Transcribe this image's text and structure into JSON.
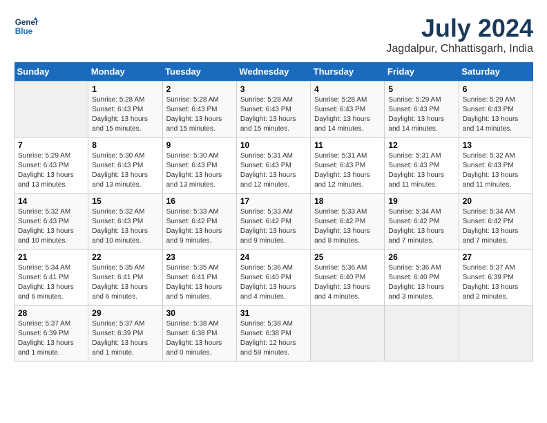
{
  "header": {
    "logo_line1": "General",
    "logo_line2": "Blue",
    "month_year": "July 2024",
    "location": "Jagdalpur, Chhattisgarh, India"
  },
  "weekdays": [
    "Sunday",
    "Monday",
    "Tuesday",
    "Wednesday",
    "Thursday",
    "Friday",
    "Saturday"
  ],
  "weeks": [
    [
      {
        "day": "",
        "info": ""
      },
      {
        "day": "1",
        "info": "Sunrise: 5:28 AM\nSunset: 6:43 PM\nDaylight: 13 hours\nand 15 minutes."
      },
      {
        "day": "2",
        "info": "Sunrise: 5:28 AM\nSunset: 6:43 PM\nDaylight: 13 hours\nand 15 minutes."
      },
      {
        "day": "3",
        "info": "Sunrise: 5:28 AM\nSunset: 6:43 PM\nDaylight: 13 hours\nand 15 minutes."
      },
      {
        "day": "4",
        "info": "Sunrise: 5:28 AM\nSunset: 6:43 PM\nDaylight: 13 hours\nand 14 minutes."
      },
      {
        "day": "5",
        "info": "Sunrise: 5:29 AM\nSunset: 6:43 PM\nDaylight: 13 hours\nand 14 minutes."
      },
      {
        "day": "6",
        "info": "Sunrise: 5:29 AM\nSunset: 6:43 PM\nDaylight: 13 hours\nand 14 minutes."
      }
    ],
    [
      {
        "day": "7",
        "info": "Sunrise: 5:29 AM\nSunset: 6:43 PM\nDaylight: 13 hours\nand 13 minutes."
      },
      {
        "day": "8",
        "info": "Sunrise: 5:30 AM\nSunset: 6:43 PM\nDaylight: 13 hours\nand 13 minutes."
      },
      {
        "day": "9",
        "info": "Sunrise: 5:30 AM\nSunset: 6:43 PM\nDaylight: 13 hours\nand 13 minutes."
      },
      {
        "day": "10",
        "info": "Sunrise: 5:31 AM\nSunset: 6:43 PM\nDaylight: 13 hours\nand 12 minutes."
      },
      {
        "day": "11",
        "info": "Sunrise: 5:31 AM\nSunset: 6:43 PM\nDaylight: 13 hours\nand 12 minutes."
      },
      {
        "day": "12",
        "info": "Sunrise: 5:31 AM\nSunset: 6:43 PM\nDaylight: 13 hours\nand 11 minutes."
      },
      {
        "day": "13",
        "info": "Sunrise: 5:32 AM\nSunset: 6:43 PM\nDaylight: 13 hours\nand 11 minutes."
      }
    ],
    [
      {
        "day": "14",
        "info": "Sunrise: 5:32 AM\nSunset: 6:43 PM\nDaylight: 13 hours\nand 10 minutes."
      },
      {
        "day": "15",
        "info": "Sunrise: 5:32 AM\nSunset: 6:43 PM\nDaylight: 13 hours\nand 10 minutes."
      },
      {
        "day": "16",
        "info": "Sunrise: 5:33 AM\nSunset: 6:42 PM\nDaylight: 13 hours\nand 9 minutes."
      },
      {
        "day": "17",
        "info": "Sunrise: 5:33 AM\nSunset: 6:42 PM\nDaylight: 13 hours\nand 9 minutes."
      },
      {
        "day": "18",
        "info": "Sunrise: 5:33 AM\nSunset: 6:42 PM\nDaylight: 13 hours\nand 8 minutes."
      },
      {
        "day": "19",
        "info": "Sunrise: 5:34 AM\nSunset: 6:42 PM\nDaylight: 13 hours\nand 7 minutes."
      },
      {
        "day": "20",
        "info": "Sunrise: 5:34 AM\nSunset: 6:42 PM\nDaylight: 13 hours\nand 7 minutes."
      }
    ],
    [
      {
        "day": "21",
        "info": "Sunrise: 5:34 AM\nSunset: 6:41 PM\nDaylight: 13 hours\nand 6 minutes."
      },
      {
        "day": "22",
        "info": "Sunrise: 5:35 AM\nSunset: 6:41 PM\nDaylight: 13 hours\nand 6 minutes."
      },
      {
        "day": "23",
        "info": "Sunrise: 5:35 AM\nSunset: 6:41 PM\nDaylight: 13 hours\nand 5 minutes."
      },
      {
        "day": "24",
        "info": "Sunrise: 5:36 AM\nSunset: 6:40 PM\nDaylight: 13 hours\nand 4 minutes."
      },
      {
        "day": "25",
        "info": "Sunrise: 5:36 AM\nSunset: 6:40 PM\nDaylight: 13 hours\nand 4 minutes."
      },
      {
        "day": "26",
        "info": "Sunrise: 5:36 AM\nSunset: 6:40 PM\nDaylight: 13 hours\nand 3 minutes."
      },
      {
        "day": "27",
        "info": "Sunrise: 5:37 AM\nSunset: 6:39 PM\nDaylight: 13 hours\nand 2 minutes."
      }
    ],
    [
      {
        "day": "28",
        "info": "Sunrise: 5:37 AM\nSunset: 6:39 PM\nDaylight: 13 hours\nand 1 minute."
      },
      {
        "day": "29",
        "info": "Sunrise: 5:37 AM\nSunset: 6:39 PM\nDaylight: 13 hours\nand 1 minute."
      },
      {
        "day": "30",
        "info": "Sunrise: 5:38 AM\nSunset: 6:38 PM\nDaylight: 13 hours\nand 0 minutes."
      },
      {
        "day": "31",
        "info": "Sunrise: 5:38 AM\nSunset: 6:38 PM\nDaylight: 12 hours\nand 59 minutes."
      },
      {
        "day": "",
        "info": ""
      },
      {
        "day": "",
        "info": ""
      },
      {
        "day": "",
        "info": ""
      }
    ]
  ]
}
